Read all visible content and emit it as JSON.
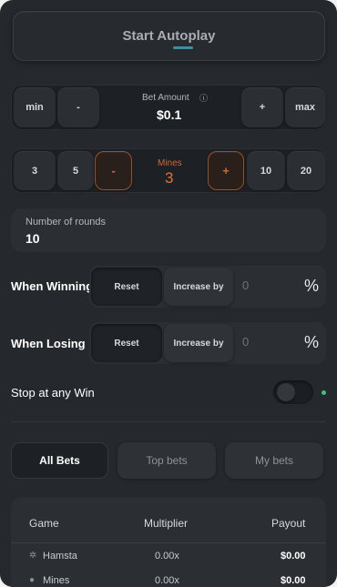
{
  "start_button": {
    "label": "Start Autoplay"
  },
  "bet": {
    "min_label": "min",
    "minus_label": "-",
    "amount_label": "Bet Amount",
    "amount_value": "$0.1",
    "plus_label": "+",
    "max_label": "max"
  },
  "mines": {
    "quick": [
      "3",
      "5",
      "10",
      "20"
    ],
    "minus_label": "-",
    "plus_label": "+",
    "label": "Mines",
    "value": "3"
  },
  "rounds": {
    "label": "Number of rounds",
    "value": "10"
  },
  "when_winning": {
    "label": "When Winning",
    "reset_label": "Reset",
    "increase_label": "Increase by",
    "value": "0",
    "unit": "%"
  },
  "when_losing": {
    "label": "When Losing",
    "reset_label": "Reset",
    "increase_label": "Increase by",
    "value": "0",
    "unit": "%"
  },
  "stop_at_win": {
    "label": "Stop at any Win",
    "enabled": false
  },
  "tabs": [
    {
      "label": "All Bets",
      "active": true
    },
    {
      "label": "Top bets",
      "active": false
    },
    {
      "label": "My bets",
      "active": false
    }
  ],
  "table": {
    "headers": [
      "Game",
      "Multiplier",
      "Payout"
    ],
    "rows": [
      {
        "game": "Hamsta",
        "icon": "hamster-icon",
        "multiplier": "0.00x",
        "payout": "$0.00"
      },
      {
        "game": "Mines",
        "icon": "mine-icon",
        "multiplier": "0.00x",
        "payout": "$0.00"
      }
    ]
  },
  "colors": {
    "accent_orange": "#d0672f",
    "toggle_dot": "#3ec46d",
    "accent_teal": "#3f8ea0"
  }
}
